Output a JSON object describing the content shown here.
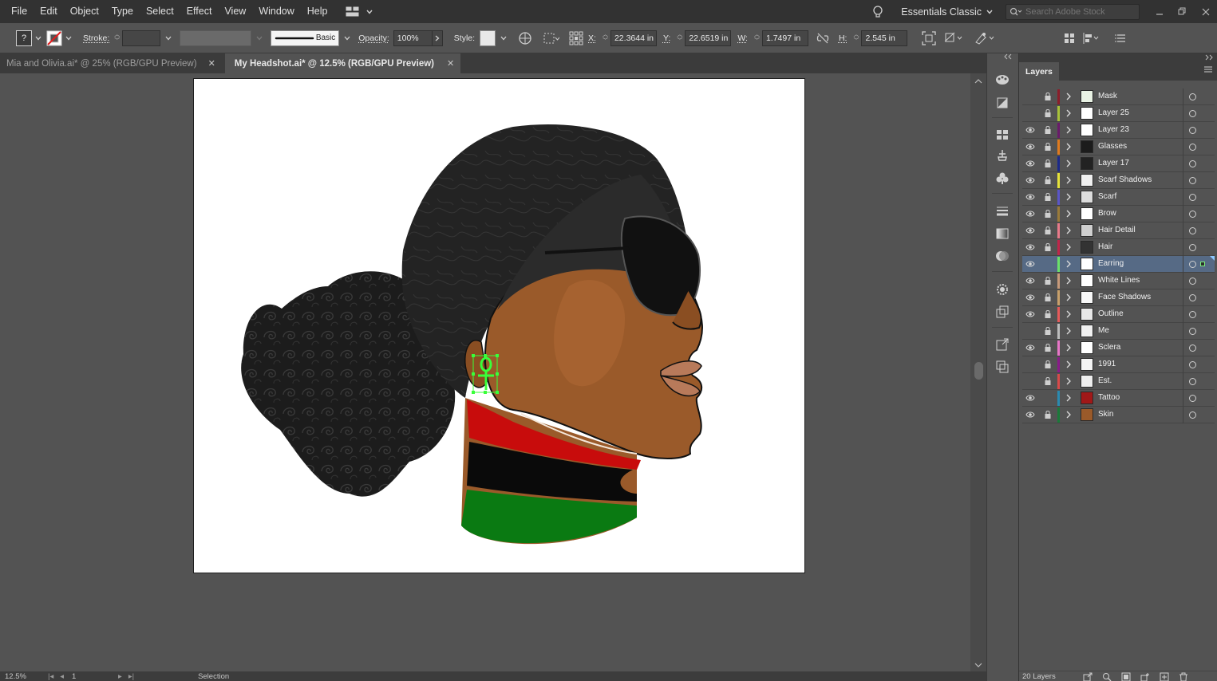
{
  "menubar": {
    "items": [
      "File",
      "Edit",
      "Object",
      "Type",
      "Select",
      "Effect",
      "View",
      "Window",
      "Help"
    ],
    "workspace": "Essentials Classic",
    "search_placeholder": "Search Adobe Stock"
  },
  "control": {
    "fill_value": "?",
    "stroke_label": "Stroke:",
    "brush_label": "Basic",
    "opacity_label": "Opacity:",
    "opacity_value": "100%",
    "style_label": "Style:",
    "x_label": "X:",
    "x_value": "22.3644 in",
    "y_label": "Y:",
    "y_value": "22.6519 in",
    "w_label": "W:",
    "w_value": "1.7497 in",
    "h_label": "H:",
    "h_value": "2.545 in"
  },
  "tabs": [
    {
      "label": "Mia and Olivia.ai* @ 25% (RGB/GPU Preview)"
    },
    {
      "label": "My Headshot.ai* @ 12.5% (RGB/GPU Preview)"
    }
  ],
  "status": {
    "zoom": "12.5%",
    "artboard": "1",
    "tool": "Selection"
  },
  "panel": {
    "title": "Layers",
    "footer_count": "20 Layers"
  },
  "layers": [
    {
      "name": "Mask",
      "color": "#8c1e2a",
      "eye": false,
      "lock": true,
      "selected": false,
      "thumb": "#e9f2e4"
    },
    {
      "name": "Layer 25",
      "color": "#a8c23a",
      "eye": false,
      "lock": true,
      "selected": false,
      "thumb": "#ffffff"
    },
    {
      "name": "Layer 23",
      "color": "#6a1b6a",
      "eye": true,
      "lock": true,
      "selected": false,
      "thumb": "#ffffff"
    },
    {
      "name": "Glasses",
      "color": "#e07a1e",
      "eye": true,
      "lock": true,
      "selected": false,
      "thumb": "#1c1c1c"
    },
    {
      "name": "Layer 17",
      "color": "#1c2a8a",
      "eye": true,
      "lock": true,
      "selected": false,
      "thumb": "#222222"
    },
    {
      "name": "Scarf Shadows",
      "color": "#e6e23a",
      "eye": true,
      "lock": true,
      "selected": false,
      "thumb": "#f0f0f0"
    },
    {
      "name": "Scarf",
      "color": "#5a55c8",
      "eye": true,
      "lock": true,
      "selected": false,
      "thumb": "#dcdcdc"
    },
    {
      "name": "Brow",
      "color": "#9a7a3a",
      "eye": true,
      "lock": true,
      "selected": false,
      "thumb": "#ffffff"
    },
    {
      "name": "Hair Detail",
      "color": "#e87a8a",
      "eye": true,
      "lock": true,
      "selected": false,
      "thumb": "#cfcfcf"
    },
    {
      "name": "Hair",
      "color": "#c0254a",
      "eye": true,
      "lock": true,
      "selected": false,
      "thumb": "#333333"
    },
    {
      "name": "Earring",
      "color": "#6ae06a",
      "eye": true,
      "lock": false,
      "selected": true,
      "thumb": "#ffffff"
    },
    {
      "name": "White Lines",
      "color": "#c79a7a",
      "eye": true,
      "lock": true,
      "selected": false,
      "thumb": "#ffffff"
    },
    {
      "name": "Face Shadows",
      "color": "#c8a06a",
      "eye": true,
      "lock": true,
      "selected": false,
      "thumb": "#f8f8f8"
    },
    {
      "name": "Outline",
      "color": "#e65a5a",
      "eye": true,
      "lock": true,
      "selected": false,
      "thumb": "#e8e8e8"
    },
    {
      "name": "Me",
      "color": "#bcbcbc",
      "eye": false,
      "lock": true,
      "selected": false,
      "thumb": "#f0f0f0"
    },
    {
      "name": "Sclera",
      "color": "#e876c8",
      "eye": true,
      "lock": true,
      "selected": false,
      "thumb": "#ffffff"
    },
    {
      "name": "1991",
      "color": "#8a1a8a",
      "eye": false,
      "lock": true,
      "selected": false,
      "thumb": "#f4f4f4"
    },
    {
      "name": "Est.",
      "color": "#d84a4a",
      "eye": false,
      "lock": true,
      "selected": false,
      "thumb": "#eeeeee"
    },
    {
      "name": "Tattoo",
      "color": "#2a8ab0",
      "eye": true,
      "lock": false,
      "selected": false,
      "thumb": "#a01818"
    },
    {
      "name": "Skin",
      "color": "#1a7a3a",
      "eye": true,
      "lock": true,
      "selected": false,
      "thumb": "#9a5a2a"
    }
  ],
  "colors": {
    "ui_bg": "#535353",
    "menubar_bg": "#323232",
    "selection_row": "#566a85",
    "selection_bbox": "#39ff39",
    "skin": "#9a5a2a",
    "hair": "#1e1e1e",
    "scarf": "#2a2a2a",
    "band_red": "#c80c0c",
    "band_black": "#0a0a0a",
    "band_green": "#0a7a12"
  }
}
